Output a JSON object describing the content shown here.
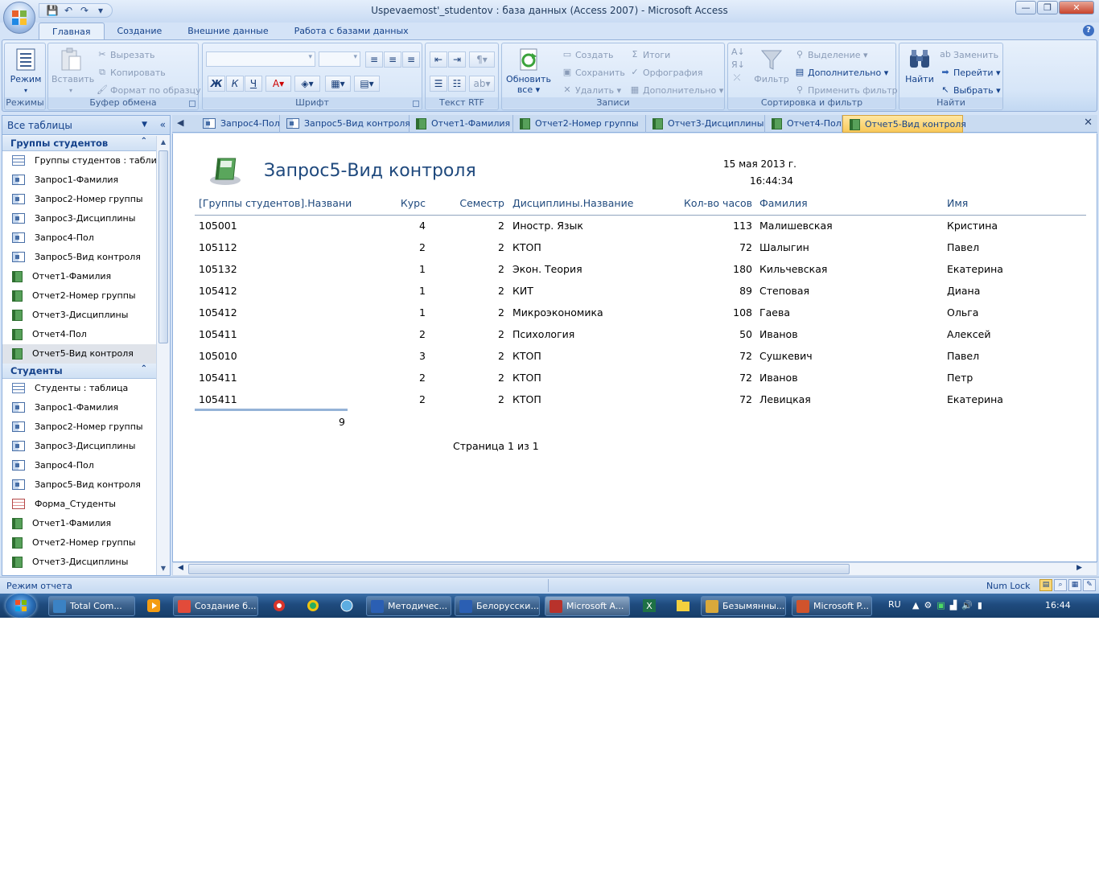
{
  "window": {
    "title": "Uspevaemost'_studentov : база данных (Access 2007) - Microsoft Access",
    "controls": {
      "minimize": "—",
      "maximize": "❐",
      "close": "✕"
    }
  },
  "qat": {
    "save": "💾",
    "undo": "↶",
    "redo": "↷",
    "customize": "▾"
  },
  "ribbon_tabs": [
    "Главная",
    "Создание",
    "Внешние данные",
    "Работа с базами данных"
  ],
  "ribbon": {
    "groups": {
      "modes": "Режимы",
      "clipboard": "Буфер обмена",
      "font": "Шрифт",
      "rtf": "Текст RTF",
      "records": "Записи",
      "sort_filter": "Сортировка и фильтр",
      "find": "Найти"
    },
    "mode_button": "Режим",
    "paste": "Вставить",
    "cut": "Вырезать",
    "copy": "Копировать",
    "format_painter": "Формат по образцу",
    "bold": "Ж",
    "italic": "К",
    "underline": "Ч",
    "refresh_all_1": "Обновить",
    "refresh_all_2": "все ▾",
    "rec_new": "Создать",
    "rec_save": "Сохранить",
    "rec_delete": "Удалить ▾",
    "totals": "Итоги",
    "spelling": "Орфография",
    "more": "Дополнительно ▾",
    "filter": "Фильтр",
    "selection": "Выделение ▾",
    "advanced": "Дополнительно ▾",
    "apply_filter": "Применить фильтр",
    "find": "Найти",
    "replace": "Заменить",
    "goto": "Перейти ▾",
    "select": "Выбрать ▾"
  },
  "nav": {
    "header": "Все таблицы",
    "groups": [
      {
        "title": "Группы студентов",
        "items": [
          {
            "label": "Группы студентов : табли...",
            "type": "table"
          },
          {
            "label": "Запрос1-Фамилия",
            "type": "query"
          },
          {
            "label": "Запрос2-Номер группы",
            "type": "query"
          },
          {
            "label": "Запрос3-Дисциплины",
            "type": "query"
          },
          {
            "label": "Запрос4-Пол",
            "type": "query"
          },
          {
            "label": "Запрос5-Вид контроля",
            "type": "query"
          },
          {
            "label": "Отчет1-Фамилия",
            "type": "report"
          },
          {
            "label": "Отчет2-Номер группы",
            "type": "report"
          },
          {
            "label": "Отчет3-Дисциплины",
            "type": "report"
          },
          {
            "label": "Отчет4-Пол",
            "type": "report"
          },
          {
            "label": "Отчет5-Вид контроля",
            "type": "report"
          }
        ]
      },
      {
        "title": "Студенты",
        "items": [
          {
            "label": "Студенты : таблица",
            "type": "table"
          },
          {
            "label": "Запрос1-Фамилия",
            "type": "query"
          },
          {
            "label": "Запрос2-Номер группы",
            "type": "query"
          },
          {
            "label": "Запрос3-Дисциплины",
            "type": "query"
          },
          {
            "label": "Запрос4-Пол",
            "type": "query"
          },
          {
            "label": "Запрос5-Вид контроля",
            "type": "query"
          },
          {
            "label": "Форма_Студенты",
            "type": "form"
          },
          {
            "label": "Отчет1-Фамилия",
            "type": "report"
          },
          {
            "label": "Отчет2-Номер группы",
            "type": "report"
          },
          {
            "label": "Отчет3-Дисциплины",
            "type": "report"
          }
        ]
      }
    ]
  },
  "doc_tabs": [
    {
      "label": "Запрос4-Пол",
      "type": "query"
    },
    {
      "label": "Запрос5-Вид контроля",
      "type": "query"
    },
    {
      "label": "Отчет1-Фамилия",
      "type": "report"
    },
    {
      "label": "Отчет2-Номер группы",
      "type": "report"
    },
    {
      "label": "Отчет3-Дисциплины",
      "type": "report"
    },
    {
      "label": "Отчет4-Пол",
      "type": "report"
    },
    {
      "label": "Отчет5-Вид контроля",
      "type": "report",
      "active": true
    }
  ],
  "report": {
    "title": "Запрос5-Вид контроля",
    "date": "15 мая 2013 г.",
    "time": "16:44:34",
    "columns": [
      "[Группы студентов].Названи",
      "Курс",
      "Семестр",
      "Дисциплины.Название",
      "Кол-во часов",
      "Фамилия",
      "Имя"
    ],
    "rows": [
      [
        "105001",
        "4",
        "2",
        "Иностр. Язык",
        "113",
        "Малишевская",
        "Кристина"
      ],
      [
        "105112",
        "2",
        "2",
        "КТОП",
        "72",
        "Шалыгин",
        "Павел"
      ],
      [
        "105132",
        "1",
        "2",
        "Экон. Теория",
        "180",
        "Кильчевская",
        "Екатерина"
      ],
      [
        "105412",
        "1",
        "2",
        "КИТ",
        "89",
        "Степовая",
        "Диана"
      ],
      [
        "105412",
        "1",
        "2",
        "Микроэкономика",
        "108",
        "Гаева",
        "Ольга"
      ],
      [
        "105411",
        "2",
        "2",
        "Психология",
        "50",
        "Иванов",
        "Алексей"
      ],
      [
        "105010",
        "3",
        "2",
        "КТОП",
        "72",
        "Сушкевич",
        "Павел"
      ],
      [
        "105411",
        "2",
        "2",
        "КТОП",
        "72",
        "Иванов",
        "Петр"
      ],
      [
        "105411",
        "2",
        "2",
        "КТОП",
        "72",
        "Левицкая",
        "Екатерина"
      ]
    ],
    "count": "9",
    "page_label": "Страница 1 из 1"
  },
  "status": {
    "mode": "Режим отчета",
    "numlock": "Num Lock"
  },
  "taskbar": {
    "items": [
      {
        "label": "Total Com...",
        "color": "#3b82c4"
      },
      {
        "label": "Создание б...",
        "color": "#e24b3a"
      },
      {
        "label": "Методичес...",
        "color": "#2b5fb3"
      },
      {
        "label": "Белорусски...",
        "color": "#2b5fb3"
      },
      {
        "label": "Microsoft A...",
        "color": "#b8322b",
        "active": true
      },
      {
        "label": "Безымянны...",
        "color": "#d9a93b"
      },
      {
        "label": "Microsoft P...",
        "color": "#d0532c"
      }
    ],
    "lang": "RU",
    "clock": "16:44"
  }
}
